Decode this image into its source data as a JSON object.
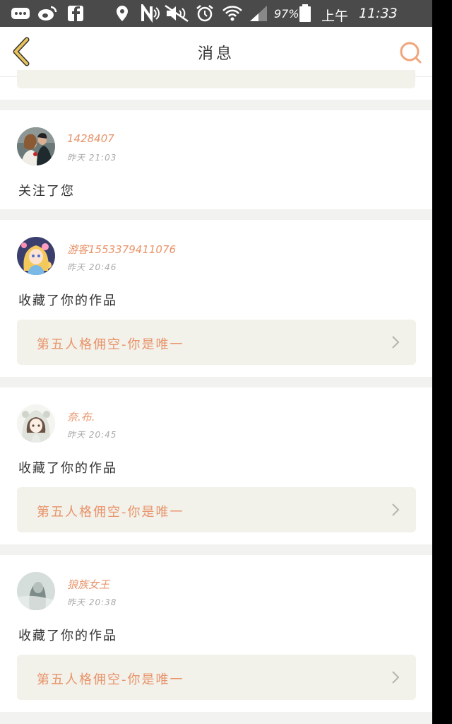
{
  "status_bar": {
    "battery": "97%",
    "time_period": "上午",
    "time": "11:33"
  },
  "header": {
    "title": "消息"
  },
  "notifications": [
    {
      "username": "1428407",
      "timestamp": "昨天 21:03",
      "action": "关注了您",
      "avatar_icon": "avatar-couple"
    },
    {
      "username": "游客1553379411076",
      "timestamp": "昨天 20:46",
      "action": "收藏了你的作品",
      "work_title": "第五人格佣空-你是唯一",
      "avatar_icon": "avatar-anime-girl"
    },
    {
      "username": "奈.布.",
      "timestamp": "昨天 20:45",
      "action": "收藏了你的作品",
      "work_title": "第五人格佣空-你是唯一",
      "avatar_icon": "avatar-hooded-girl"
    },
    {
      "username": "狼族女王",
      "timestamp": "昨天 20:38",
      "action": "收藏了你的作品",
      "work_title": "第五人格佣空-你是唯一",
      "avatar_icon": "avatar-misty-figure"
    }
  ],
  "colors": {
    "accent": "#e8946a",
    "back_arrow": "#e8c25a",
    "link_bg": "#f2f1ea"
  }
}
